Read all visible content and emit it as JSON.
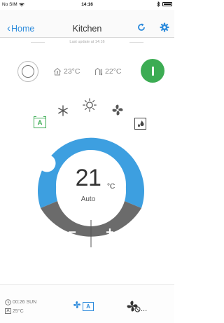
{
  "status_bar": {
    "carrier": "No SIM",
    "time": "14:16"
  },
  "nav": {
    "back_label": "Home",
    "title": "Kitchen"
  },
  "last_update": "Last update at 14:16",
  "indoor_temp": "23°C",
  "outdoor_temp": "22°C",
  "setpoint": {
    "value": "21",
    "unit": "°C",
    "mode_label": "Auto",
    "minus_label": "−",
    "plus_label": "+"
  },
  "mode_icons": [
    "auto",
    "cool",
    "heat",
    "fan",
    "dry"
  ],
  "selected_mode": "auto",
  "timer": {
    "time_label": "00:26 SUN",
    "temp_label": "25°C",
    "auto_glyph": "A"
  },
  "bottom": {
    "mode_glyph": "A",
    "fan_dots": "..."
  },
  "mode_auto_glyph": "A",
  "colors": {
    "accent_blue": "#2d8bdc",
    "ring_blue": "#3d9fe0",
    "ring_grey": "#6b6b6b",
    "power_green": "#3cac53"
  }
}
